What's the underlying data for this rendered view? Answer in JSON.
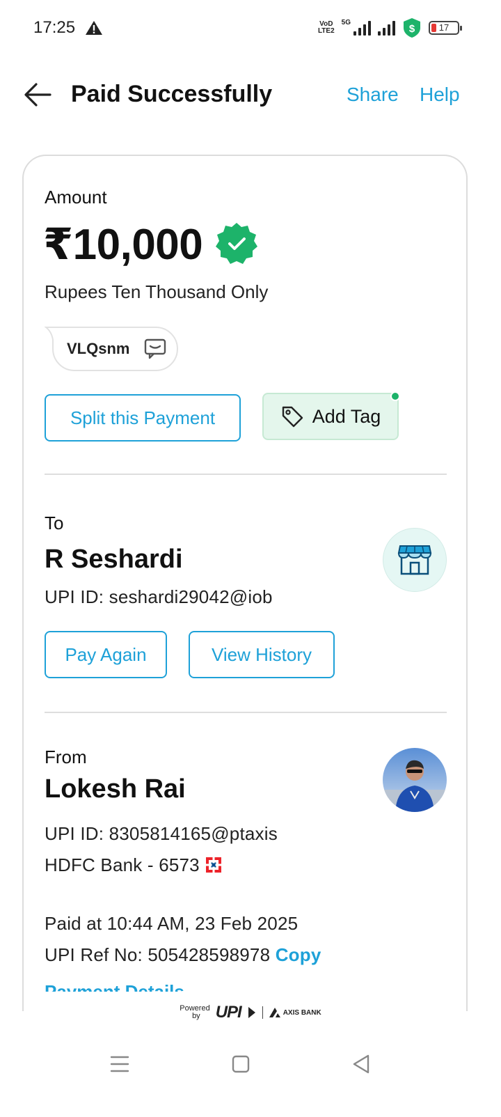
{
  "status_bar": {
    "time": "17:25",
    "network_label_top": "VoD",
    "network_label_bottom": "LTE2",
    "network_type": "5G",
    "battery_percent": "17"
  },
  "header": {
    "title": "Paid Successfully",
    "share_label": "Share",
    "help_label": "Help"
  },
  "payment": {
    "amount_label": "Amount",
    "amount": "₹10,000",
    "amount_words": "Rupees Ten Thousand Only",
    "note": "VLQsnm",
    "split_label": "Split this Payment",
    "tag_label": "Add Tag"
  },
  "to": {
    "label": "To",
    "name": "R Seshardi",
    "upi_id": "UPI ID: seshardi29042@iob",
    "pay_again_label": "Pay Again",
    "view_history_label": "View History"
  },
  "from": {
    "label": "From",
    "name": "Lokesh Rai",
    "upi_id": "UPI ID: 8305814165@ptaxis",
    "bank": "HDFC Bank - 6573"
  },
  "transaction": {
    "paid_at": "Paid at 10:44 AM, 23 Feb 2025",
    "ref_no": "UPI Ref No: 505428598978",
    "copy_label": "Copy",
    "details_link": "Payment Details"
  },
  "footer": {
    "powered_line1": "Powered",
    "powered_line2": "by",
    "upi_text": "UPI",
    "bank_text": "AXIS BANK"
  },
  "colors": {
    "accent": "#1ea1d8",
    "success": "#1db36a",
    "tag_bg": "#e4f6ec"
  }
}
